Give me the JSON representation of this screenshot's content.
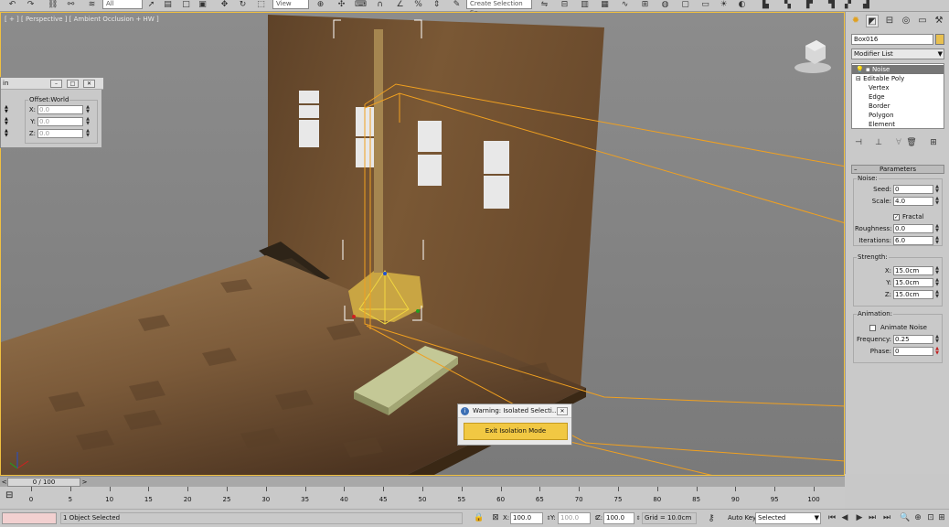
{
  "toolbar": {
    "filter_value": "All",
    "view_value": "View",
    "selection_set_placeholder": "Create Selection Se"
  },
  "viewport": {
    "label": "[ + ] [ Perspective ] [ Ambient Occlusion + HW ]"
  },
  "float_panel": {
    "title": "in",
    "offset_title": "Offset:World",
    "x_label": "X:",
    "x_value": "0.0",
    "y_label": "Y:",
    "y_value": "0.0",
    "z_label": "Z:",
    "z_value": "0.0"
  },
  "command_panel": {
    "object_name": "Box016",
    "modifier_list": "Modifier List",
    "stack": [
      "Noise",
      "Editable Poly",
      "Vertex",
      "Edge",
      "Border",
      "Polygon",
      "Element"
    ],
    "rollout_title": "Parameters",
    "noise_group": "Noise:",
    "seed_label": "Seed:",
    "seed_value": "0",
    "scale_label": "Scale:",
    "scale_value": "4.0",
    "fractal_label": "Fractal",
    "roughness_label": "Roughness:",
    "roughness_value": "0.0",
    "iterations_label": "Iterations:",
    "iterations_value": "6.0",
    "strength_group": "Strength:",
    "sx_label": "X:",
    "sx_value": "15.0cm",
    "sy_label": "Y:",
    "sy_value": "15.0cm",
    "sz_label": "Z:",
    "sz_value": "15.0cm",
    "animation_group": "Animation:",
    "animate_noise_label": "Animate Noise",
    "frequency_label": "Frequency:",
    "frequency_value": "0.25",
    "phase_label": "Phase:",
    "phase_value": "0"
  },
  "warning_dialog": {
    "title": "Warning: Isolated Selecti...",
    "button": "Exit Isolation Mode"
  },
  "time_slider": {
    "label": "0 / 100",
    "ticks": [
      "0",
      "5",
      "10",
      "15",
      "20",
      "25",
      "30",
      "35",
      "40",
      "45",
      "50",
      "55",
      "60",
      "65",
      "70",
      "75",
      "80",
      "85",
      "90",
      "95",
      "100"
    ]
  },
  "status": {
    "selection_text": "1 Object Selected",
    "x_label": "X:",
    "x_value": "100.0",
    "y_label": "Y:",
    "y_value": "100.0",
    "z_label": "Z:",
    "z_value": "100.0",
    "grid_text": "Grid = 10.0cm",
    "autokey_label": "Auto Key",
    "key_filter_value": "Selected"
  },
  "colors": {
    "viewport_bg": "#8a8a8a",
    "wall": "#6e5132",
    "floor": "#8e6b45",
    "selection": "#f0a020",
    "accent_button": "#f1c843"
  }
}
